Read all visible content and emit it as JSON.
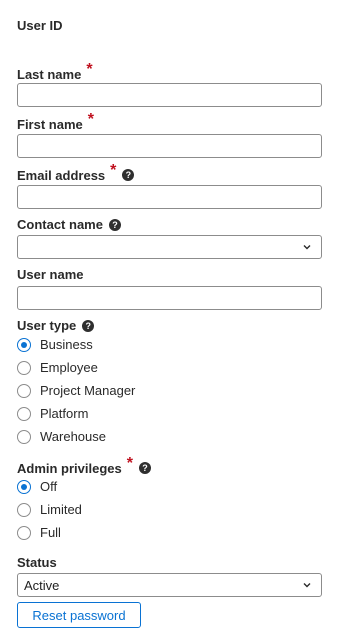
{
  "fields": {
    "user_id": {
      "label": "User ID"
    },
    "last_name": {
      "label": "Last name",
      "required": "*",
      "value": ""
    },
    "first_name": {
      "label": "First name",
      "required": "*",
      "value": ""
    },
    "email": {
      "label": "Email address",
      "required": "*",
      "help": "?",
      "value": ""
    },
    "contact_name": {
      "label": "Contact name",
      "help": "?",
      "value": ""
    },
    "user_name": {
      "label": "User name",
      "value": ""
    },
    "user_type": {
      "label": "User type",
      "help": "?",
      "options": [
        "Business",
        "Employee",
        "Project Manager",
        "Platform",
        "Warehouse"
      ],
      "selected": "Business"
    },
    "admin_privileges": {
      "label": "Admin privileges",
      "required": "*",
      "help": "?",
      "options": [
        "Off",
        "Limited",
        "Full"
      ],
      "selected": "Off"
    },
    "status": {
      "label": "Status",
      "value": "Active"
    }
  },
  "actions": {
    "reset_password": "Reset password"
  },
  "icons": {
    "help": "help-circle-icon",
    "dropdown": "chevron-down-icon"
  },
  "colors": {
    "accent": "#0972d3",
    "required": "#c0111f",
    "border": "#8c8c8c"
  }
}
